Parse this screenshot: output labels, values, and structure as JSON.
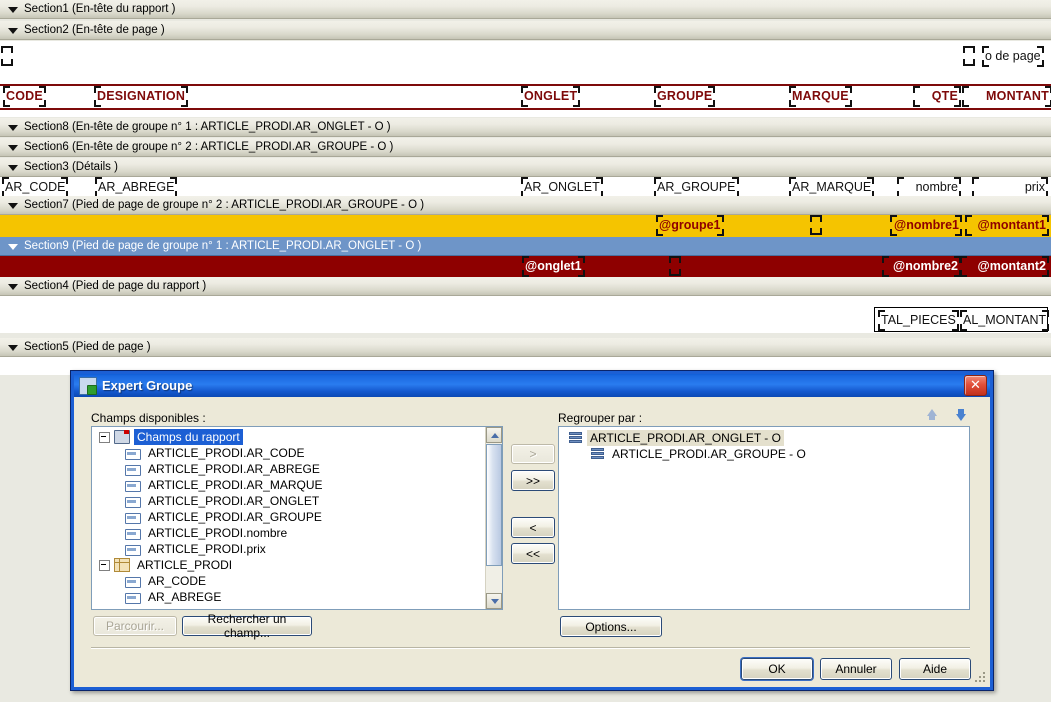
{
  "designer": {
    "sections": [
      {
        "id": "s1",
        "label": "Section1 (En-tête du rapport  )"
      },
      {
        "id": "s2",
        "label": "Section2 (En-tête de page  )"
      },
      {
        "id": "s8",
        "label": "Section8 (En-tête de groupe n° 1 : ARTICLE_PRODI.AR_ONGLET - O )"
      },
      {
        "id": "s6",
        "label": "Section6 (En-tête de groupe n° 2 : ARTICLE_PRODI.AR_GROUPE - O )"
      },
      {
        "id": "s3",
        "label": "Section3 (Détails  )"
      },
      {
        "id": "s7",
        "label": "Section7 (Pied de page de groupe n° 2 : ARTICLE_PRODI.AR_GROUPE - O )"
      },
      {
        "id": "s9",
        "label": "Section9 (Pied de page de groupe n° 1 : ARTICLE_PRODI.AR_ONGLET - O )"
      },
      {
        "id": "s4",
        "label": "Section4 (Pied de page du rapport  )"
      },
      {
        "id": "s5",
        "label": "Section5 (Pied de page  )"
      }
    ],
    "page_header_field": "o de page",
    "column_headers": [
      {
        "label": "CODE"
      },
      {
        "label": "DESIGNATION"
      },
      {
        "label": "ONGLET"
      },
      {
        "label": "GROUPE"
      },
      {
        "label": "MARQUE"
      },
      {
        "label": "QTE"
      },
      {
        "label": "MONTANT"
      }
    ],
    "detail_fields": [
      {
        "label": "AR_CODE"
      },
      {
        "label": "AR_ABREGE"
      },
      {
        "label": "AR_ONGLET"
      },
      {
        "label": "AR_GROUPE"
      },
      {
        "label": "AR_MARQUE"
      },
      {
        "label": "nombre"
      },
      {
        "label": "prix"
      }
    ],
    "group2_footer_fields": [
      {
        "label": "@groupe1"
      },
      {
        "label": "@nombre1"
      },
      {
        "label": "@montant1"
      }
    ],
    "group1_footer_fields": [
      {
        "label": "@onglet1"
      },
      {
        "label": "@nombre2"
      },
      {
        "label": "@montant2"
      }
    ],
    "report_footer_fields": [
      {
        "label": "TAL_PIECES"
      },
      {
        "label": "AL_MONTANT"
      }
    ],
    "colors": {
      "rule": "#7e0a0a",
      "group2_band": "#f5c400",
      "group1_band": "#8e0000",
      "selected_section": "#6e95c8",
      "header_text": "#7e0a0a"
    }
  },
  "dialog": {
    "title": "Expert Groupe",
    "close_label": "✕",
    "left_label": "Champs disponibles :",
    "right_label": "Regrouper par :",
    "available_fields": [
      {
        "label": "Champs du rapport",
        "icon": "report-icon",
        "indent": 0,
        "expander": true,
        "state": "selected"
      },
      {
        "label": "ARTICLE_PRODI.AR_CODE",
        "icon": "field-icon",
        "indent": 1,
        "expander": false,
        "state": "normal"
      },
      {
        "label": "ARTICLE_PRODI.AR_ABREGE",
        "icon": "field-icon",
        "indent": 1,
        "expander": false,
        "state": "normal"
      },
      {
        "label": "ARTICLE_PRODI.AR_MARQUE",
        "icon": "field-icon",
        "indent": 1,
        "expander": false,
        "state": "normal"
      },
      {
        "label": "ARTICLE_PRODI.AR_ONGLET",
        "icon": "field-icon",
        "indent": 1,
        "expander": false,
        "state": "normal"
      },
      {
        "label": "ARTICLE_PRODI.AR_GROUPE",
        "icon": "field-icon",
        "indent": 1,
        "expander": false,
        "state": "normal"
      },
      {
        "label": "ARTICLE_PRODI.nombre",
        "icon": "field-icon",
        "indent": 1,
        "expander": false,
        "state": "normal"
      },
      {
        "label": "ARTICLE_PRODI.prix",
        "icon": "field-icon",
        "indent": 1,
        "expander": false,
        "state": "normal"
      },
      {
        "label": "ARTICLE_PRODI",
        "icon": "table-icon",
        "indent": 0,
        "expander": true,
        "state": "normal"
      },
      {
        "label": "AR_CODE",
        "icon": "field-icon",
        "indent": 1,
        "expander": false,
        "state": "normal"
      },
      {
        "label": "AR_ABREGE",
        "icon": "field-icon",
        "indent": 1,
        "expander": false,
        "state": "normal"
      }
    ],
    "group_by": [
      {
        "label": "ARTICLE_PRODI.AR_ONGLET - O",
        "indent": 0,
        "state": "highlight"
      },
      {
        "label": "ARTICLE_PRODI.AR_GROUPE - O",
        "indent": 1,
        "state": "normal"
      }
    ],
    "transfer_buttons": [
      {
        "label": ">",
        "enabled": false
      },
      {
        "label": ">>",
        "enabled": true
      },
      {
        "label": "<",
        "enabled": true
      },
      {
        "label": "<<",
        "enabled": true
      }
    ],
    "browse_button": {
      "label": "Parcourir...",
      "enabled": false
    },
    "find_button": {
      "label": "Rechercher un champ...",
      "enabled": true
    },
    "options_button": {
      "label": "Options...",
      "enabled": true
    },
    "ok_button": {
      "label": "OK",
      "enabled": true,
      "default": true
    },
    "cancel_button": {
      "label": "Annuler",
      "enabled": true
    },
    "help_button": {
      "label": "Aide",
      "enabled": true
    }
  }
}
